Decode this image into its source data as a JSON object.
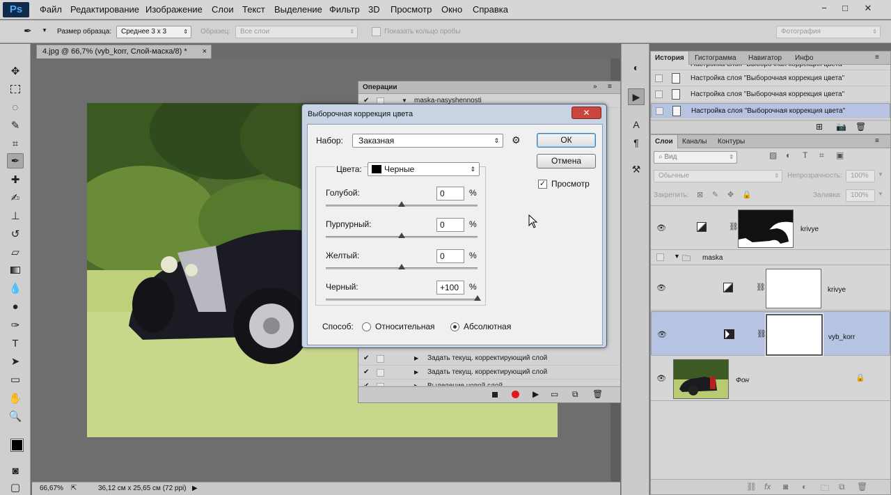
{
  "app": {
    "logo": "Ps"
  },
  "menu": [
    "Файл",
    "Редактирование",
    "Изображение",
    "Слои",
    "Текст",
    "Выделение",
    "Фильтр",
    "3D",
    "Просмотр",
    "Окно",
    "Справка"
  ],
  "window_controls": {
    "minimize": "−",
    "maximize": "□",
    "close": "✕"
  },
  "options": {
    "sample_size_label": "Размер образца:",
    "sample_size_value": "Среднее 3 х 3",
    "sample_label": "Образец:",
    "sample_value": "Все слои",
    "show_ring_label": "Показать кольцо пробы",
    "workspace_value": "Фотография"
  },
  "document": {
    "tab_title": "4.jpg @ 66,7% (vyb_korr, Слой-маска/8) *",
    "tab_close": "×",
    "zoom": "66,67%",
    "doc_info": "36,12 см x 25,65 см (72 ppi)"
  },
  "actions_panel": {
    "tab": "Операции",
    "rows": [
      {
        "check": "✔",
        "label": "maska-nasyshennosti",
        "expanded": true
      },
      {
        "check": "✔",
        "label": "Задать текущ. корректирующий слой",
        "expanded": false
      },
      {
        "check": "✔",
        "label": "Задать текущ. корректирующий слой",
        "expanded": false
      },
      {
        "check": "✔",
        "label": "Выделение новой слой",
        "expanded": false
      }
    ]
  },
  "history_panel": {
    "tabs": [
      "История",
      "Гистограмма",
      "Навигатор",
      "Инфо"
    ],
    "rows": [
      {
        "label": "Настройка слоя \"Выборочная коррекция цвета\"",
        "selected": false
      },
      {
        "label": "Настройка слоя \"Выборочная коррекция цвета\"",
        "selected": false
      },
      {
        "label": "Настройка слоя \"Выборочная коррекция цвета\"",
        "selected": false
      },
      {
        "label": "Настройка слоя \"Выборочная коррекция цвета\"",
        "selected": true
      }
    ]
  },
  "layers_panel": {
    "tabs": [
      "Слои",
      "Каналы",
      "Контуры"
    ],
    "filter": "Вид",
    "blend_mode": "Обычные",
    "opacity_label": "Непрозрачность:",
    "opacity_value": "100%",
    "lock_label": "Закрепить:",
    "fill_label": "Заливка:",
    "fill_value": "100%",
    "layers": [
      {
        "name": "krivye",
        "visible": true,
        "selected": false,
        "kind": "curves"
      },
      {
        "name": "maska",
        "visible": false,
        "selected": false,
        "kind": "group"
      },
      {
        "name": "krivye",
        "visible": true,
        "selected": false,
        "kind": "curves"
      },
      {
        "name": "vyb_korr",
        "visible": true,
        "selected": true,
        "kind": "selective-color"
      },
      {
        "name": "Фон",
        "visible": true,
        "selected": false,
        "kind": "background",
        "locked": true
      }
    ]
  },
  "dialog": {
    "title": "Выборочная коррекция цвета",
    "close_glyph": "✕",
    "preset_label": "Набор:",
    "preset_value": "Заказная",
    "colors_label": "Цвета:",
    "colors_value": "Черные",
    "ok": "ОК",
    "cancel": "Отмена",
    "preview_label": "Просмотр",
    "preview_checked": true,
    "sliders": [
      {
        "label": "Голубой:",
        "value": "0",
        "unit": "%",
        "fraction": 0.5
      },
      {
        "label": "Пурпурный:",
        "value": "0",
        "unit": "%",
        "fraction": 0.5
      },
      {
        "label": "Желтый:",
        "value": "0",
        "unit": "%",
        "fraction": 0.5
      },
      {
        "label": "Черный:",
        "value": "+100",
        "unit": "%",
        "fraction": 1.0
      }
    ],
    "method_label": "Способ:",
    "method_relative": "Относительная",
    "method_absolute": "Абсолютная",
    "method_selected": "absolute"
  },
  "colors": {
    "selection": "#b7c3e3",
    "ps_blue": "#4aa8ff",
    "close_red": "#c9463d"
  }
}
